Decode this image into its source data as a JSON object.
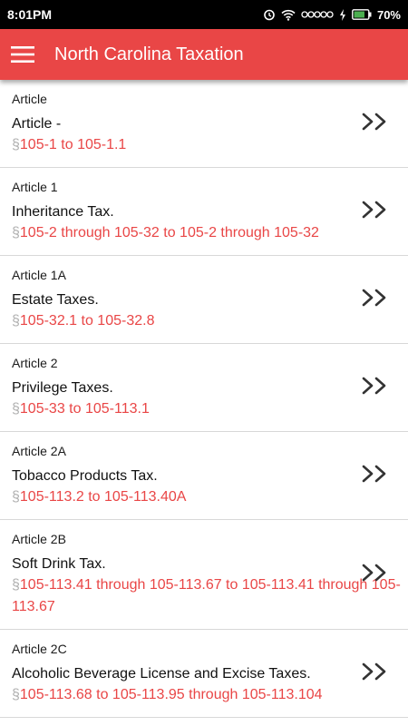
{
  "status_bar": {
    "time": "8:01PM",
    "battery": "70%"
  },
  "app_bar": {
    "title": "North Carolina Taxation"
  },
  "colors": {
    "accent": "#e94646",
    "section_symbol": "#b0b0b0"
  },
  "items": [
    {
      "article": "Article",
      "title": "Article -",
      "symbol": "§",
      "section": "105-1 to 105-1.1"
    },
    {
      "article": "Article 1",
      "title": "Inheritance Tax.",
      "symbol": "§",
      "section": "105-2 through 105-32 to 105-2 through 105-32"
    },
    {
      "article": "Article 1A",
      "title": "Estate Taxes.",
      "symbol": "§",
      "section": "105-32.1 to 105-32.8"
    },
    {
      "article": "Article 2",
      "title": "Privilege Taxes.",
      "symbol": "§",
      "section": "105-33 to 105-113.1"
    },
    {
      "article": "Article 2A",
      "title": "Tobacco Products Tax.",
      "symbol": "§",
      "section": "105-113.2 to 105-113.40A"
    },
    {
      "article": "Article 2B",
      "title": "Soft Drink Tax.",
      "symbol": "§",
      "section": "105-113.41 through 105-113.67 to 105-113.41 through 105-113.67"
    },
    {
      "article": "Article 2C",
      "title": "Alcoholic Beverage License and Excise Taxes.",
      "symbol": "§",
      "section": "105-113.68 to 105-113.95 through 105-113.104"
    }
  ]
}
